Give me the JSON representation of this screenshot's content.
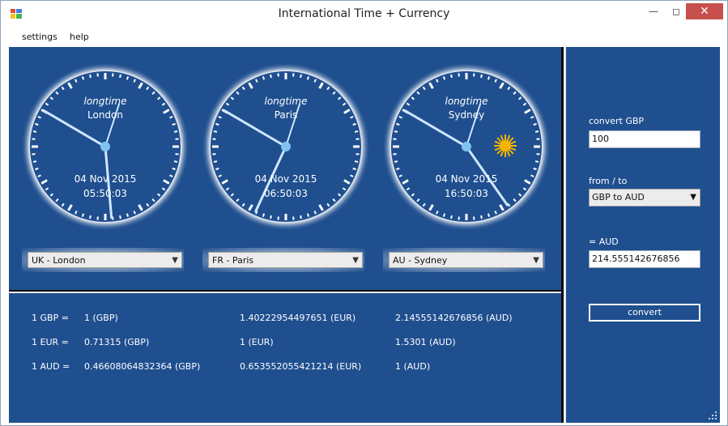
{
  "window": {
    "title": "International Time + Currency"
  },
  "menu": {
    "items": [
      "settings",
      "help"
    ]
  },
  "clocks": [
    {
      "format": "longtime",
      "city": "London",
      "date": "04 Nov 2015",
      "time": "05:50:03",
      "zone": "UK - London",
      "hours": 5,
      "minutes": 50,
      "seconds": 3,
      "daytime": false
    },
    {
      "format": "longtime",
      "city": "Paris",
      "date": "04 Nov 2015",
      "time": "06:50:03",
      "zone": "FR - Paris",
      "hours": 6,
      "minutes": 50,
      "seconds": 3,
      "daytime": false
    },
    {
      "format": "longtime",
      "city": "Sydney",
      "date": "04 Nov 2015",
      "time": "16:50:03",
      "zone": "AU - Sydney",
      "hours": 16,
      "minutes": 50,
      "seconds": 3,
      "daytime": true
    }
  ],
  "rates": [
    [
      "1 GBP =",
      "1 (GBP)",
      "1.40222954497651 (EUR)",
      "2.14555142676856 (AUD)"
    ],
    [
      "1 EUR =",
      "0.71315 (GBP)",
      "1 (EUR)",
      "1.5301 (AUD)"
    ],
    [
      "1 AUD =",
      "0.46608064832364 (GBP)",
      "0.653552055421214 (EUR)",
      "1 (AUD)"
    ]
  ],
  "converter": {
    "amount_label": "convert GBP",
    "amount_value": "100",
    "fromto_label": "from / to",
    "fromto_value": "GBP to AUD",
    "result_label": "= AUD",
    "result_value": "214.555142676856",
    "button_label": "convert"
  },
  "icons": {
    "app": "app-icon",
    "sun": "sun-icon",
    "dropdown": "chevron-down-icon",
    "grip": "resize-grip-icon"
  },
  "colors": {
    "panel": "#1f4f8f",
    "hand": "#cfe6ff",
    "hub": "#7fc4f0",
    "sun": "#f5b400"
  }
}
